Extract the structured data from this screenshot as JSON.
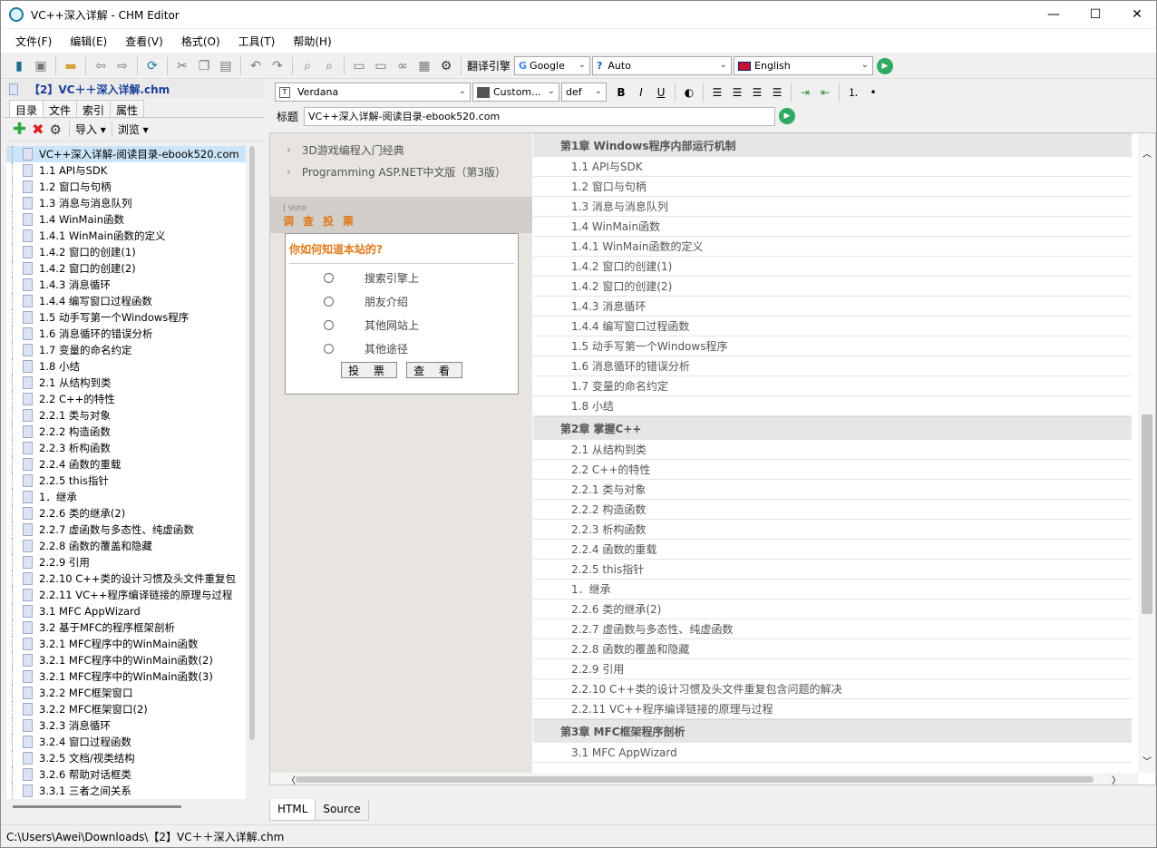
{
  "window": {
    "title": "VC++深入详解 - CHM Editor"
  },
  "menu": [
    "文件(F)",
    "编辑(E)",
    "查看(V)",
    "格式(O)",
    "工具(T)",
    "帮助(H)"
  ],
  "translate": {
    "label": "翻译引擎",
    "engine": "Google",
    "source": "Auto",
    "target": "English"
  },
  "left": {
    "title": "【2】VC＋＋深入详解.chm",
    "tabs": [
      "目录",
      "文件",
      "索引",
      "属性"
    ],
    "tools": {
      "import": "导入",
      "browse": "浏览"
    },
    "tree": [
      "VC++深入详解-阅读目录-ebook520.com",
      "1.1 API与SDK",
      "1.2 窗口与句柄",
      "1.3 消息与消息队列",
      "1.4 WinMain函数",
      "1.4.1 WinMain函数的定义",
      "1.4.2 窗口的创建(1)",
      "1.4.2 窗口的创建(2)",
      "1.4.3 消息循环",
      "1.4.4 编写窗口过程函数",
      "1.5 动手写第一个Windows程序",
      "1.6 消息循环的错误分析",
      "1.7 变量的命名约定",
      "1.8 小结",
      "2.1 从结构到类",
      "2.2 C++的特性",
      "2.2.1 类与对象",
      "2.2.2 构造函数",
      "2.2.3 析构函数",
      "2.2.4 函数的重载",
      "2.2.5 this指针",
      "1．继承",
      "2.2.6 类的继承(2)",
      "2.2.7 虚函数与多态性、纯虚函数",
      "2.2.8 函数的覆盖和隐藏",
      "2.2.9 引用",
      "2.2.10 C++类的设计习惯及头文件重复包",
      "2.2.11 VC++程序编译链接的原理与过程",
      "3.1 MFC AppWizard",
      "3.2 基于MFC的程序框架剖析",
      "3.2.1 MFC程序中的WinMain函数",
      "3.2.1 MFC程序中的WinMain函数(2)",
      "3.2.1 MFC程序中的WinMain函数(3)",
      "3.2.2 MFC框架窗口",
      "3.2.2 MFC框架窗口(2)",
      "3.2.3 消息循环",
      "3.2.4 窗口过程函数",
      "3.2.5 文档/视类结构",
      "3.2.6 帮助对话框类",
      "3.3.1 三者之间关系"
    ]
  },
  "format": {
    "font": "Verdana",
    "color": "Custom...",
    "size": "def"
  },
  "subject": {
    "label": "标题",
    "value": "VC++深入详解-阅读目录-ebook520.com"
  },
  "page": {
    "links": [
      "3D游戏编程入门经典",
      "Programming ASP.NET中文版（第3版）"
    ],
    "vote": {
      "en": "| Vote",
      "cn": "调查投票",
      "question": "你如何知道本站的?",
      "options": [
        "搜索引擎上",
        "朋友介绍",
        "其他网站上",
        "其他途径"
      ],
      "vote_btn": "投 票",
      "view_btn": "查 看"
    },
    "chapters": [
      {
        "title": "第1章 Windows程序内部运行机制",
        "items": [
          "1.1 API与SDK",
          "1.2 窗口与句柄",
          "1.3 消息与消息队列",
          "1.4 WinMain函数",
          "1.4.1 WinMain函数的定义",
          "1.4.2 窗口的创建(1)",
          "1.4.2 窗口的创建(2)",
          "1.4.3 消息循环",
          "1.4.4 编写窗口过程函数",
          "1.5 动手写第一个Windows程序",
          "1.6 消息循环的错误分析",
          "1.7 变量的命名约定",
          "1.8 小结"
        ]
      },
      {
        "title": "第2章 掌握C++",
        "items": [
          "2.1 从结构到类",
          "2.2 C++的特性",
          "2.2.1 类与对象",
          "2.2.2 构造函数",
          "2.2.3 析构函数",
          "2.2.4 函数的重载",
          "2.2.5 this指针",
          "1．继承",
          "2.2.6 类的继承(2)",
          "2.2.7 虚函数与多态性、纯虚函数",
          "2.2.8 函数的覆盖和隐藏",
          "2.2.9 引用",
          "2.2.10 C++类的设计习惯及头文件重复包含问题的解决",
          "2.2.11 VC++程序编译链接的原理与过程"
        ]
      },
      {
        "title": "第3章 MFC框架程序剖析",
        "items": [
          "3.1 MFC AppWizard"
        ]
      }
    ]
  },
  "bottom_tabs": [
    "HTML",
    "Source"
  ],
  "status": "C:\\Users\\Awei\\Downloads\\【2】VC＋＋深入详解.chm"
}
